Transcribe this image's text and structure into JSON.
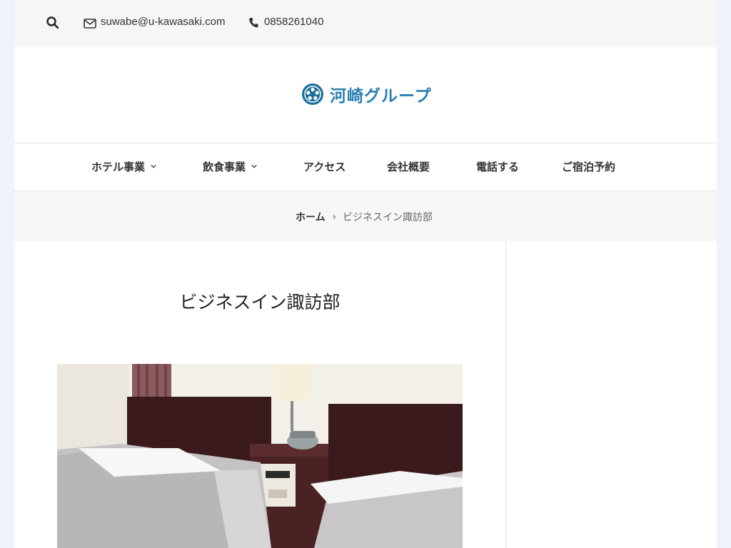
{
  "topbar": {
    "search_icon": "search-icon",
    "email": "suwabe@u-kawasaki.com",
    "phone": "0858261040"
  },
  "header": {
    "logo_text": "河崎グループ",
    "brand_color": "#2a7fae"
  },
  "nav": {
    "items": [
      {
        "label": "ホテル事業",
        "has_submenu": true
      },
      {
        "label": "飲食事業",
        "has_submenu": true
      },
      {
        "label": "アクセス",
        "has_submenu": false
      },
      {
        "label": "会社概要",
        "has_submenu": false
      },
      {
        "label": "電話する",
        "has_submenu": false
      },
      {
        "label": "ご宿泊予約",
        "has_submenu": false
      }
    ]
  },
  "breadcrumb": {
    "home": "ホーム",
    "current": "ビジネスイン諏訪部"
  },
  "main": {
    "title": "ビジネスイン諏訪部"
  }
}
